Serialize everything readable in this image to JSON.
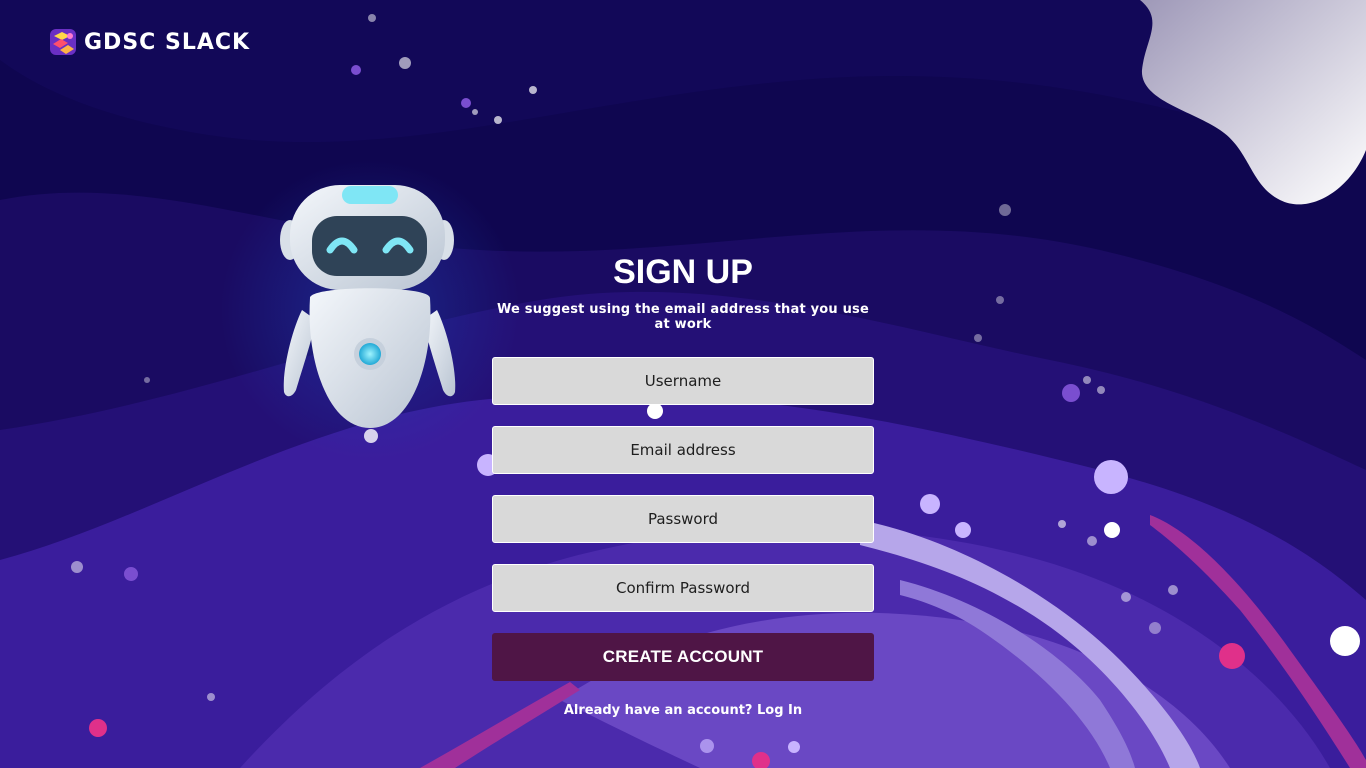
{
  "brand": {
    "name": "GDSC SLACK",
    "icon": "gdsc-logo-icon"
  },
  "illustration": {
    "icon": "robot-illustration"
  },
  "signup": {
    "title": "SIGN UP",
    "subtitle": "We suggest using the email address that you use at work",
    "fields": {
      "username": {
        "placeholder": "Username",
        "value": ""
      },
      "email": {
        "placeholder": "Email address",
        "value": ""
      },
      "password": {
        "placeholder": "Password",
        "value": ""
      },
      "confirm_password": {
        "placeholder": "Confirm Password",
        "value": ""
      }
    },
    "submit_label": "CREATE ACCOUNT",
    "login_prompt": "Already have an account?",
    "login_link": "Log In"
  },
  "colors": {
    "background": "#0f0650",
    "field_background": "#d9d9d9",
    "button_background": "#4f1546",
    "text": "#ffffff"
  }
}
